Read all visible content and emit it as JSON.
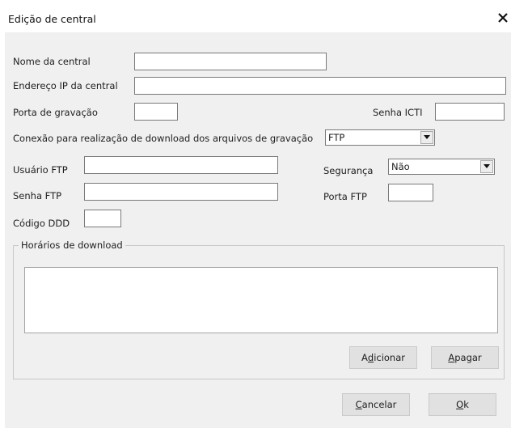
{
  "window": {
    "title": "Edição de central"
  },
  "form": {
    "nome_label": "Nome da central",
    "nome_value": "",
    "ip_label": "Endereço IP da central",
    "ip_value": "",
    "porta_gravacao_label": "Porta de gravação",
    "porta_gravacao_value": "",
    "senha_icti_label": "Senha ICTI",
    "senha_icti_value": "",
    "conexao_label": "Conexão para realização de download dos arquivos de gravação",
    "conexao_value": "FTP",
    "usuario_ftp_label": "Usuário FTP",
    "usuario_ftp_value": "",
    "seguranca_label": "Segurança",
    "seguranca_value": "Não",
    "senha_ftp_label": "Senha FTP",
    "senha_ftp_value": "",
    "porta_ftp_label": "Porta FTP",
    "porta_ftp_value": "",
    "ddd_label": "Código DDD",
    "ddd_value": ""
  },
  "horarios": {
    "legend": "Horários de download",
    "items": []
  },
  "buttons": {
    "adicionar_pre": "A",
    "adicionar_key": "d",
    "adicionar_post": "icionar",
    "apagar_key": "A",
    "apagar_post": "pagar",
    "cancelar_key": "C",
    "cancelar_post": "ancelar",
    "ok_key": "O",
    "ok_post": "k"
  },
  "icons": {
    "close": "close-icon",
    "dropdown": "chevron-down-icon"
  }
}
